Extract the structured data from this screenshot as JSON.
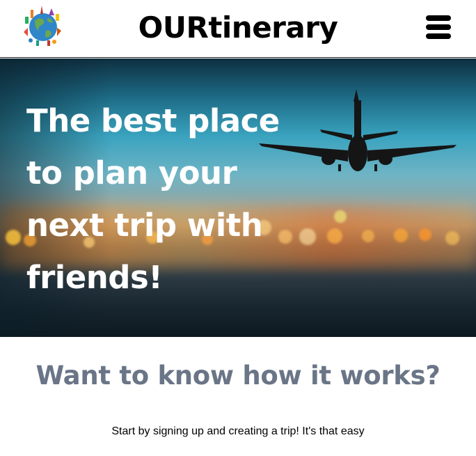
{
  "header": {
    "logo_icon": "globe-landmarks-icon",
    "brand": "OURtinerary",
    "menu_icon": "hamburger-menu-icon"
  },
  "hero": {
    "headline_lines": [
      "The best place",
      "to plan your",
      "next trip with",
      "friends!"
    ],
    "image": "airplane-sunset-photo"
  },
  "how_it_works": {
    "title": "Want to know how it works?",
    "text": "Start by signing up and creating a trip! It's that easy"
  },
  "colors": {
    "section_title": "#6a7587",
    "hero_text": "#ffffff",
    "header_border": "#222222"
  }
}
